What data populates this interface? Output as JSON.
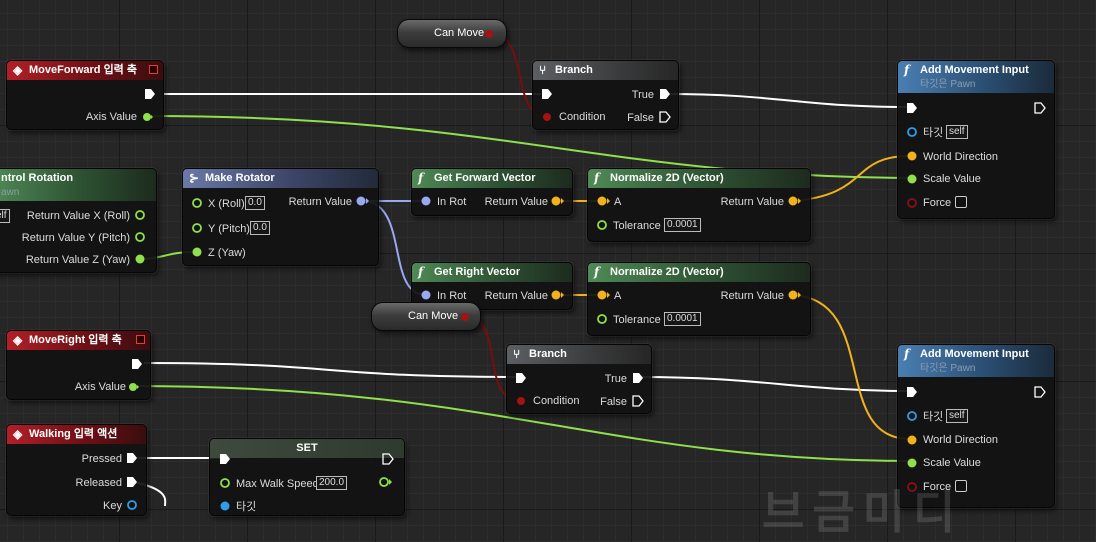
{
  "nodes": {
    "can_move_top": {
      "label": "Can Move"
    },
    "can_move_mid": {
      "label": "Can Move"
    },
    "moveforward": {
      "title": "MoveForward 입력 축",
      "axis_value": "Axis Value"
    },
    "moveright": {
      "title": "MoveRight 입력 축",
      "axis_value": "Axis Value"
    },
    "walking": {
      "title": "Walking 입력 액션",
      "pressed": "Pressed",
      "released": "Released",
      "key": "Key"
    },
    "control_rotation": {
      "title": "ntrol Rotation",
      "subtitle": "awn",
      "self_value": "elf",
      "out_x": "Return Value X (Roll)",
      "out_y": "Return Value Y (Pitch)",
      "out_z": "Return Value Z (Yaw)"
    },
    "make_rotator": {
      "title": "Make Rotator",
      "x_label": "X (Roll)",
      "x_value": "0.0",
      "y_label": "Y (Pitch)",
      "y_value": "0.0",
      "z_label": "Z (Yaw)",
      "return_value": "Return Value"
    },
    "branch_top": {
      "title": "Branch",
      "condition": "Condition",
      "true_label": "True",
      "false_label": "False"
    },
    "branch_mid": {
      "title": "Branch",
      "condition": "Condition",
      "true_label": "True",
      "false_label": "False"
    },
    "get_forward": {
      "title": "Get Forward Vector",
      "in_rot": "In Rot",
      "return_value": "Return Value"
    },
    "get_right": {
      "title": "Get Right Vector",
      "in_rot": "In Rot",
      "return_value": "Return Value"
    },
    "normalize_top": {
      "title": "Normalize 2D (Vector)",
      "a": "A",
      "tolerance": "Tolerance",
      "tolerance_value": "0.0001",
      "return_value": "Return Value"
    },
    "normalize_mid": {
      "title": "Normalize 2D (Vector)",
      "a": "A",
      "tolerance": "Tolerance",
      "tolerance_value": "0.0001",
      "return_value": "Return Value"
    },
    "add_movement_top": {
      "title": "Add Movement Input",
      "subtitle": "타깃은 Pawn",
      "target": "타깃",
      "target_value": "self",
      "world_direction": "World Direction",
      "scale_value": "Scale Value",
      "force": "Force"
    },
    "add_movement_bottom": {
      "title": "Add Movement Input",
      "subtitle": "타깃은 Pawn",
      "target": "타깃",
      "target_value": "self",
      "world_direction": "World Direction",
      "scale_value": "Scale Value",
      "force": "Force"
    },
    "set_node": {
      "title": "SET",
      "max_walk_speed": "Max Walk Speed",
      "max_walk_speed_value": "200.0",
      "target": "타깃"
    }
  },
  "colors": {
    "exec": "#ffffff",
    "float": "#8fe04a",
    "vector": "#f2b21c",
    "rotator": "#99a8f0",
    "bool": "#8c1010",
    "object": "#2f9ee8",
    "event_header": "#b21f27",
    "function_header": "#4a7fb3"
  },
  "watermark": "브금미디"
}
